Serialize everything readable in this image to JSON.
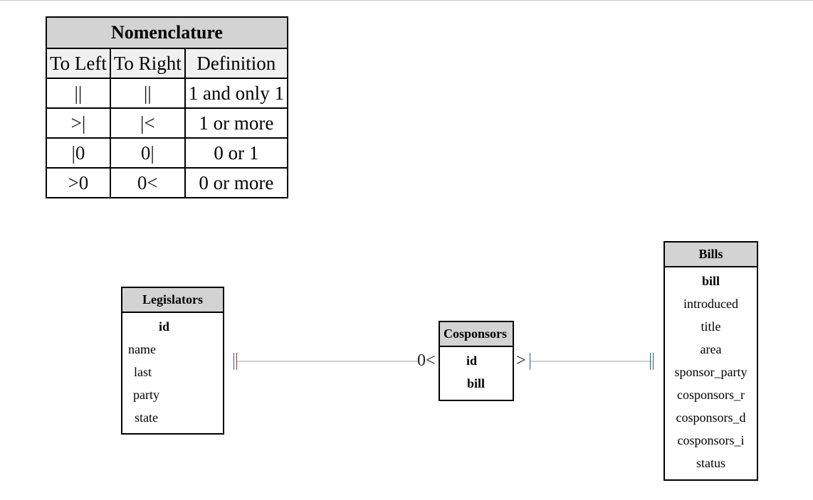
{
  "nomenclature": {
    "title": "Nomenclature",
    "headers": [
      "To Left",
      "To Right",
      "Definition"
    ],
    "rows": [
      {
        "left": "||",
        "right": "||",
        "definition": "1 and only 1"
      },
      {
        "left": ">|",
        "right": "|<",
        "definition": "1 or more"
      },
      {
        "left": "|0",
        "right": "0|",
        "definition": "0 or 1"
      },
      {
        "left": ">0",
        "right": "0<",
        "definition": "0 or more"
      }
    ]
  },
  "entities": {
    "legislators": {
      "name": "Legislators",
      "attributes": [
        "id",
        "name",
        "last",
        "party",
        "state"
      ],
      "primary_keys": [
        "id"
      ]
    },
    "cosponsors": {
      "name": "Cosponsors",
      "attributes": [
        "id",
        "bill"
      ],
      "primary_keys": [
        "id",
        "bill"
      ]
    },
    "bills": {
      "name": "Bills",
      "attributes": [
        "bill",
        "introduced",
        "title",
        "area",
        "sponsor_party",
        "cosponsors_r",
        "cosponsors_d",
        "cosponsors_i",
        "status"
      ],
      "primary_keys": [
        "bill"
      ]
    }
  },
  "relationships": [
    {
      "from": "Legislators",
      "to": "Cosponsors",
      "from_cardinality": "||",
      "to_cardinality": "0<"
    },
    {
      "from": "Cosponsors",
      "to": "Bills",
      "from_cardinality": ">|",
      "to_cardinality": "||"
    }
  ],
  "colors": {
    "header_fill": "#d3d3d3",
    "table_header_fill": "#f0f0f0",
    "connector": "#cfcfcf",
    "border": "#000000"
  }
}
